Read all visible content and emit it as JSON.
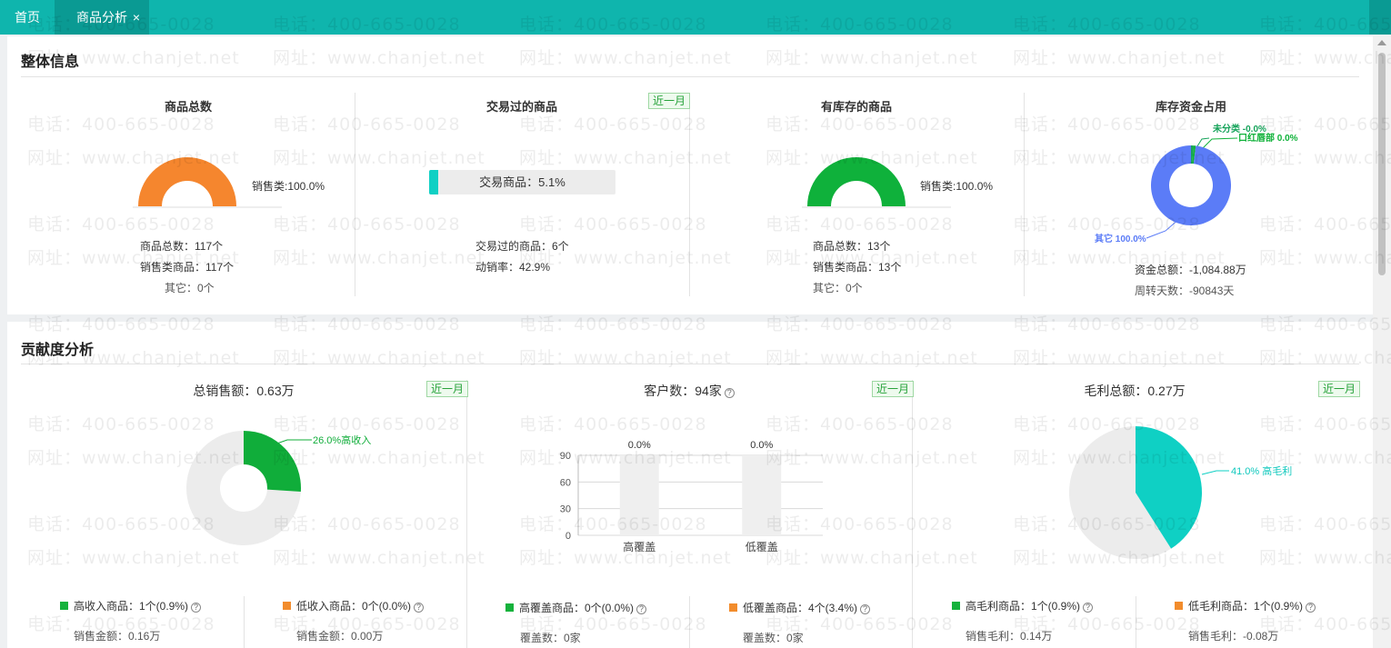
{
  "tabs": {
    "home": "首页",
    "active": "商品分析",
    "close": "×"
  },
  "overview": {
    "title": "整体信息",
    "total": {
      "title": "商品总数",
      "gauge_label": "销售类:100.0%",
      "gauge_value": 1.0,
      "color": "#f5862e",
      "lines": [
        "商品总数：117个",
        "销售类商品：117个",
        "其它：0个"
      ]
    },
    "traded": {
      "title": "交易过的商品",
      "badge": "近一月",
      "bar_label": "交易商品：5.1%",
      "bar_value": 0.051,
      "lines": [
        "交易过的商品：6个",
        "动销率：42.9%"
      ]
    },
    "stock": {
      "title": "有库存的商品",
      "gauge_label": "销售类:100.0%",
      "gauge_value": 1.0,
      "color": "#0fb13b",
      "lines": [
        "商品总数：13个",
        "销售类商品：13个",
        "其它：0个"
      ]
    },
    "capital": {
      "title": "库存资金占用",
      "slices": [
        {
          "label": "未分类 -0.0%",
          "value": 0.0,
          "color": "#16a35a"
        },
        {
          "label": "口红唇部 0.0%",
          "value": 0.0,
          "color": "#10b23a"
        },
        {
          "label": "其它 100.0%",
          "value": 100.0,
          "color": "#5b7cf7"
        }
      ],
      "lines": [
        "资金总额：-1,084.88万",
        "周转天数：-90843天"
      ]
    }
  },
  "contribution": {
    "title": "贡献度分析",
    "sales": {
      "title": "总销售额：0.63万",
      "badge": "近一月",
      "slice_label": "26.0%高收入",
      "slice_value": 26.0,
      "color": "#10ad3a",
      "left": {
        "label": "高收入商品：1个(0.9%)",
        "sub": "销售金额：0.16万"
      },
      "right": {
        "label": "低收入商品：0个(0.0%)",
        "sub": "销售金额：0.00万"
      }
    },
    "customers": {
      "title": "客户数：94家",
      "badge": "近一月",
      "chart_data": {
        "type": "bar",
        "categories": [
          "高覆盖",
          "低覆盖"
        ],
        "values": [
          0.0,
          0.0
        ],
        "data_labels": [
          "0.0%",
          "0.0%"
        ],
        "yticks": [
          "90",
          "60",
          "30",
          "0"
        ],
        "ylim": [
          0,
          90
        ]
      },
      "left": {
        "label": "高覆盖商品：0个(0.0%)",
        "sub": "覆盖数：0家"
      },
      "right": {
        "label": "低覆盖商品：4个(3.4%)",
        "sub": "覆盖数：0家"
      }
    },
    "profit": {
      "title": "毛利总额：0.27万",
      "badge": "近一月",
      "slice_label": "41.0% 高毛利",
      "slice_value": 41.0,
      "color": "#0fd0c4",
      "left": {
        "label": "高毛利商品：1个(0.9%)",
        "sub": "销售毛利：0.14万"
      },
      "right": {
        "label": "低毛利商品：1个(0.9%)",
        "sub": "销售毛利：-0.08万"
      }
    }
  },
  "watermark": {
    "phone": "电话：400-665-0028",
    "site": "网址：www.chanjet.net"
  }
}
